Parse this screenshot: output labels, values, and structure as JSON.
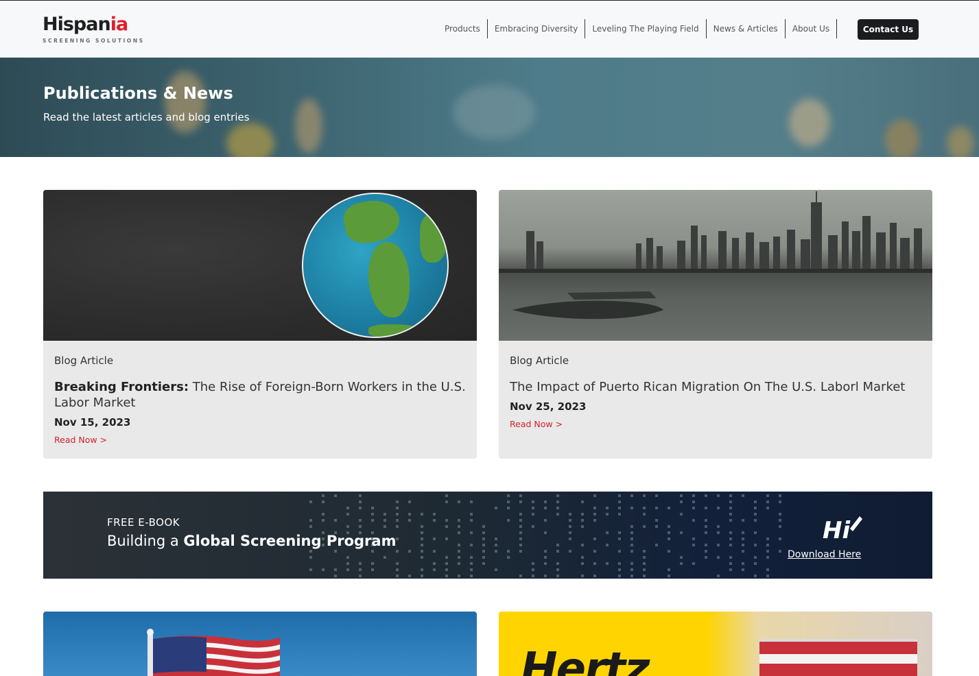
{
  "brand": {
    "name_main": "Hispan",
    "name_accent": "ia",
    "tagline": "SCREENING SOLUTIONS"
  },
  "nav": {
    "items": [
      "Products",
      "Embracing Diversity",
      "Leveling The Playing Field",
      "News & Articles",
      "About Us"
    ],
    "contact_label": "Contact Us"
  },
  "hero": {
    "title": "Publications & News",
    "subtitle": "Read the latest articles and blog entries"
  },
  "cards": [
    {
      "kind": "Blog Article",
      "title_bold": "Breaking Frontiers:",
      "title_rest": " The Rise of Foreign-Born Workers in the U.S. Labor Market",
      "date": "Nov 15, 2023",
      "link": "Read Now >",
      "image": "chalkboard-globe"
    },
    {
      "kind": "Blog Article",
      "title_bold": "",
      "title_rest": "The Impact of Puerto Rican Migration On The U.S. Laborl Market",
      "date": "Nov 25, 2023",
      "link": "Read Now >",
      "image": "new-york-skyline"
    }
  ],
  "ebook": {
    "kicker": "FREE E-BOOK",
    "title_plain": "Building a ",
    "title_bold": "Global Screening Program",
    "logo": "Hi",
    "link": "Download Here"
  },
  "bottom_cards": [
    {
      "image": "american-flag"
    },
    {
      "image": "hertz-puerto-rico",
      "logo_text": "Hertz"
    }
  ],
  "colors": {
    "accent": "#e01f2d",
    "link": "#d22030",
    "button": "#1b1c20",
    "card_bg": "#e9e9e9"
  }
}
